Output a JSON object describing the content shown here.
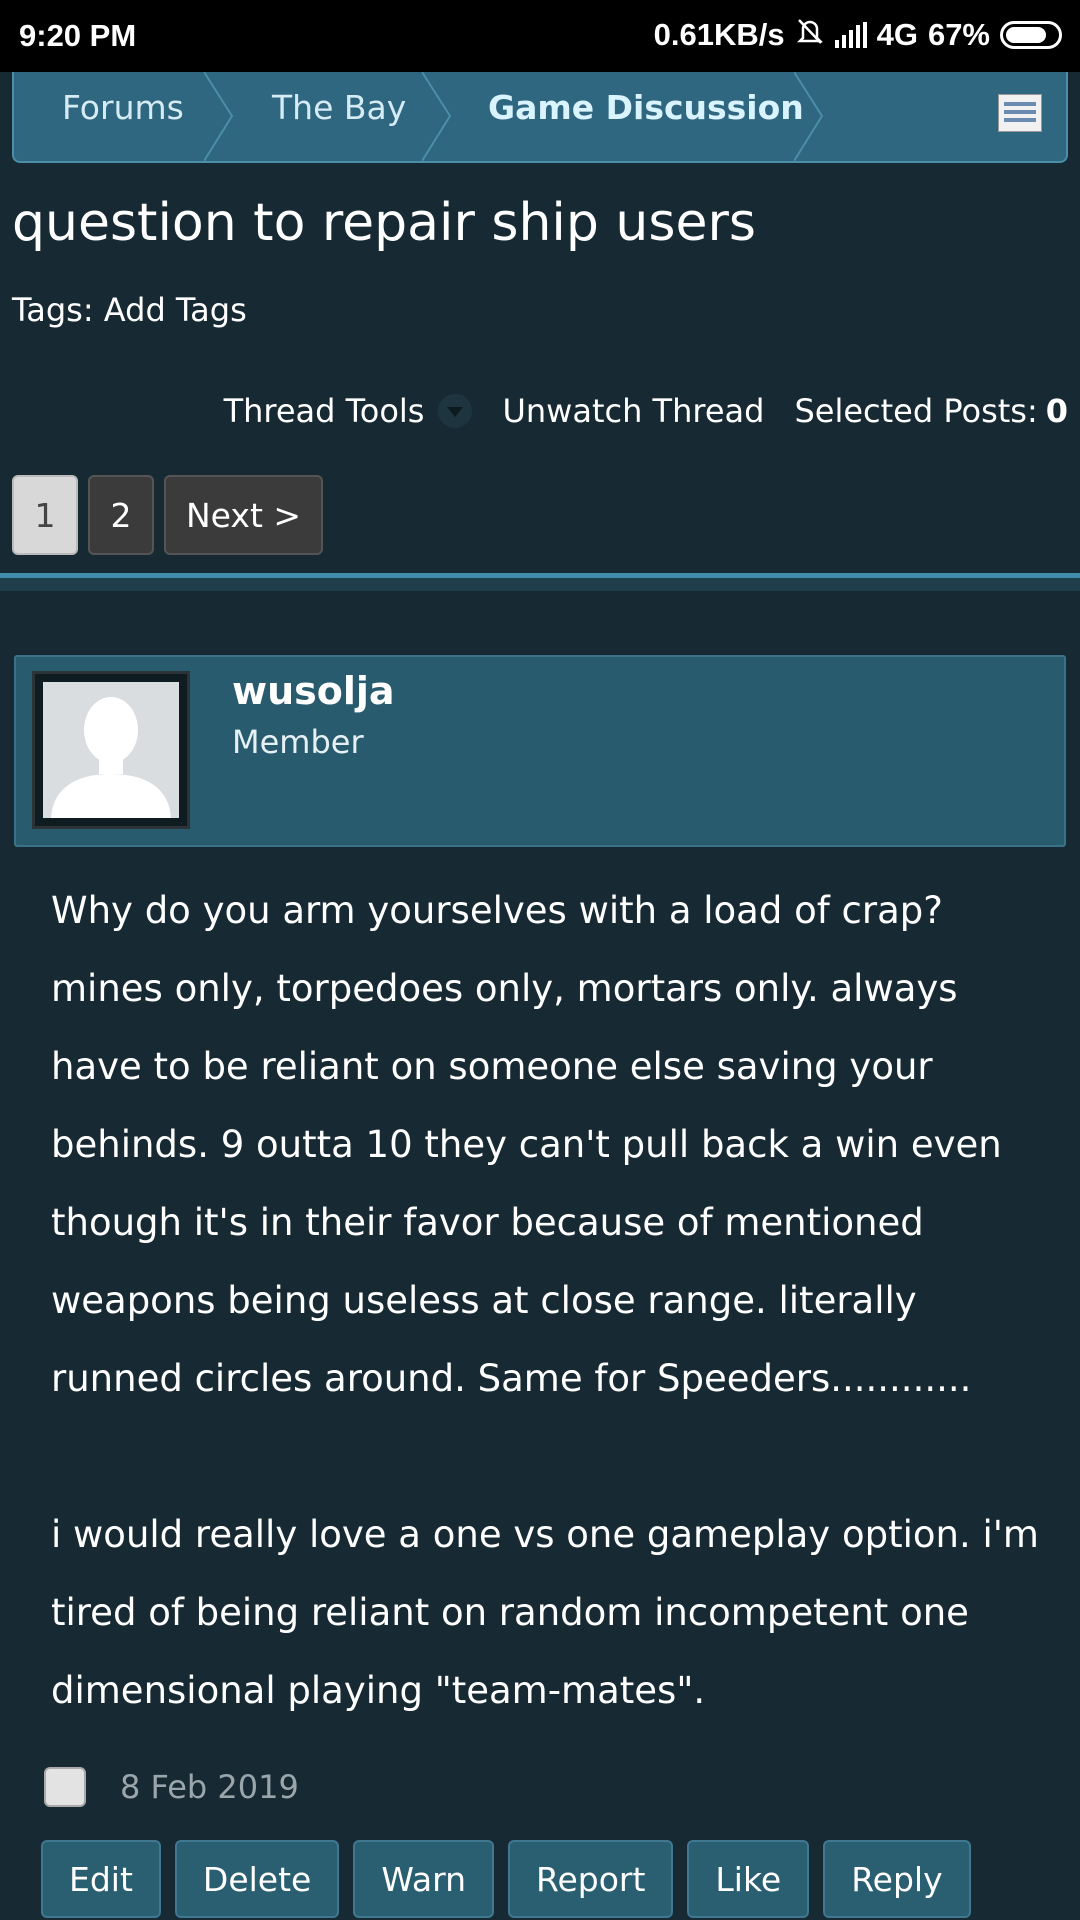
{
  "status_bar": {
    "time": "9:20 PM",
    "net_speed": "0.61KB/s",
    "network": "4G",
    "battery": "67%",
    "icons": [
      "mute-bell-icon",
      "signal-icon",
      "battery-icon"
    ]
  },
  "breadcrumb": {
    "items": [
      "Forums",
      "The Bay",
      "Game Discussion"
    ],
    "active_index": 2,
    "menu_icon": "list-view-icon"
  },
  "thread": {
    "title": "question to repair ship users",
    "tags_label": "Tags:",
    "tags_link": "Add Tags"
  },
  "tools": {
    "thread_tools": "Thread Tools",
    "unwatch": "Unwatch Thread",
    "selected_label": "Selected Posts:",
    "selected_count": "0"
  },
  "pager": {
    "pages": [
      "1",
      "2"
    ],
    "current": "1",
    "next": "Next >"
  },
  "post": {
    "username": "wusolja",
    "user_title": "Member",
    "paragraphs": [
      "Why do you arm yourselves with a load of crap? mines only, torpedoes only, mortars only. always have to be reliant on someone else saving your behinds. 9 outta 10 they can't pull back a win even though it's in their favor because of mentioned weapons being useless at close range. literally runned circles around. Same for Speeders............",
      "i would really love a one vs one gameplay option. i'm tired of being reliant on random incompetent one dimensional playing \"team-mates\"."
    ],
    "date": "8 Feb 2019",
    "actions": [
      "Edit",
      "Delete",
      "Warn",
      "Report",
      "Like",
      "Reply"
    ]
  },
  "colors": {
    "background": "#172a33",
    "breadcrumb_bg": "#2f6680",
    "userbar_bg": "#285b6d",
    "button_bg": "#2a5f72"
  }
}
